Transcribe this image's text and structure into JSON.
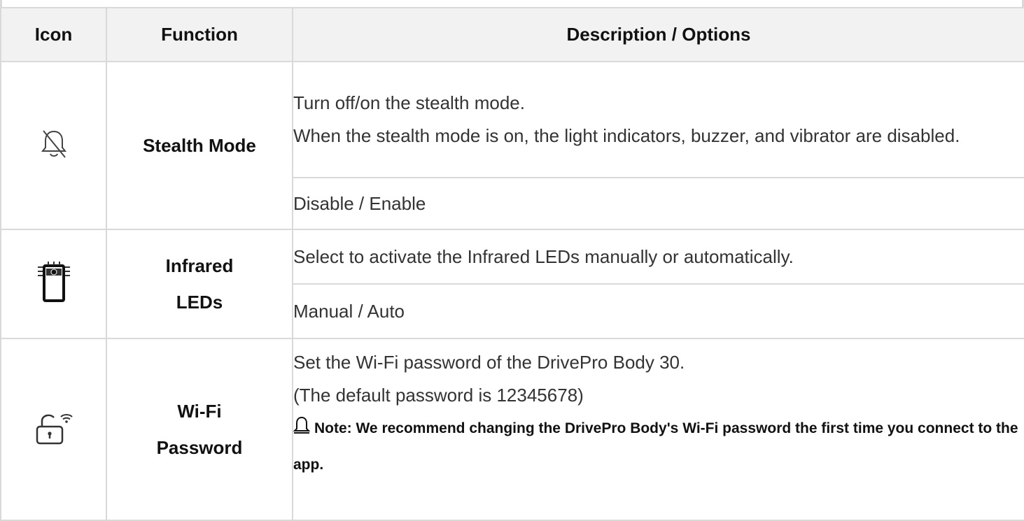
{
  "table": {
    "headers": {
      "icon": "Icon",
      "function": "Function",
      "description": "Description / Options"
    },
    "rows": [
      {
        "icon": "bell-off-icon",
        "function": "Stealth Mode",
        "description": [
          "Turn off/on the stealth mode.",
          "When the stealth mode is on, the light indicators, buzzer, and vibrator are disabled."
        ],
        "options": "Disable / Enable"
      },
      {
        "icon": "infrared-led-icon",
        "function_lines": [
          "Infrared",
          "LEDs"
        ],
        "description": "Select to activate the Infrared LEDs manually or automatically.",
        "options": "Manual / Auto"
      },
      {
        "icon": "wifi-lock-icon",
        "function_lines": [
          "Wi-Fi",
          "Password"
        ],
        "description": [
          "Set the Wi-Fi password of the DrivePro Body 30.",
          "(The default password is 12345678)"
        ],
        "note": "Note: We recommend changing the DrivePro Body's Wi-Fi password the first time you connect to the app."
      }
    ]
  }
}
